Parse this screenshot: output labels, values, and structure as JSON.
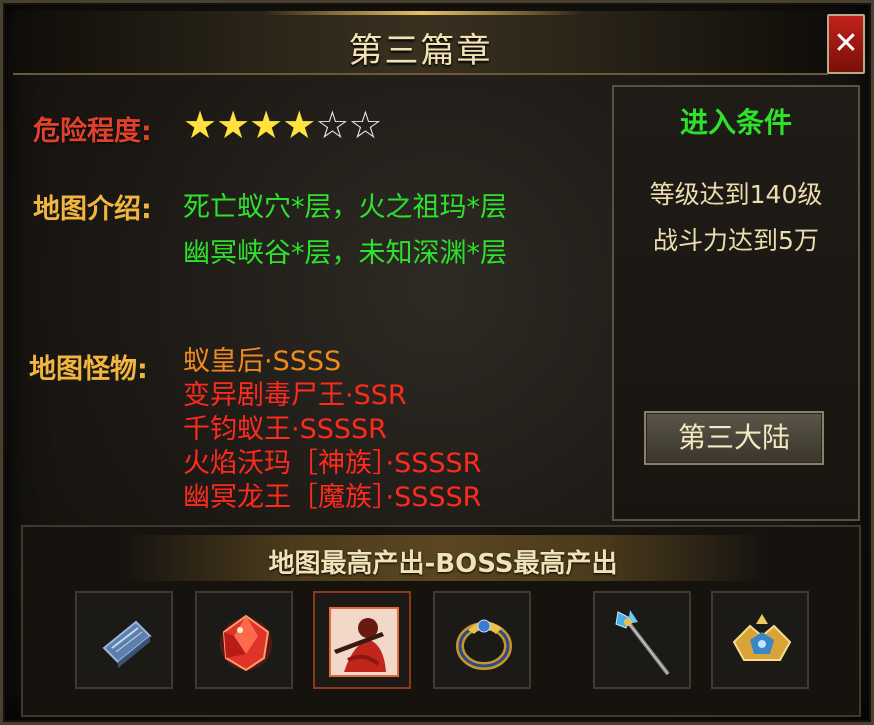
{
  "header": {
    "title": "第三篇章",
    "close_label": "✕"
  },
  "danger": {
    "label": "危险程度:",
    "rating": 4,
    "max": 6
  },
  "intro": {
    "label": "地图介绍:",
    "line1": "死亡蚁穴*层，火之祖玛*层",
    "line2": "幽冥峡谷*层，未知深渊*层"
  },
  "monsters": {
    "label": "地图怪物:",
    "items": [
      {
        "name": "蚁皇后·SSSS",
        "color": "#f08a1c"
      },
      {
        "name": "变异剧毒尸王·SSR",
        "color": "#ff2a1e"
      },
      {
        "name": "千钧蚁王·SSSSR",
        "color": "#ff2a1e"
      },
      {
        "name": "火焰沃玛［神族］·SSSSR",
        "color": "#ff2a1e"
      },
      {
        "name": "幽冥龙王［魔族］·SSSSR",
        "color": "#ff2a1e"
      }
    ]
  },
  "conditions": {
    "title": "进入条件",
    "line1": "等级达到140级",
    "line2": "战斗力达到5万",
    "button": "第三大陆"
  },
  "drops": {
    "title": "地图最高产出-BOSS最高产出",
    "items": [
      {
        "icon": "blue-book-icon"
      },
      {
        "icon": "red-gem-icon"
      },
      {
        "icon": "hero-portrait-icon"
      },
      {
        "icon": "gold-ring-icon"
      },
      {
        "icon": "staff-icon"
      },
      {
        "icon": "gold-armor-icon"
      }
    ]
  },
  "colors": {
    "danger_label": "#e0412a",
    "gold_label": "#f2b640",
    "green_text": "#2ee12c",
    "star_on": "#ffe23c"
  }
}
